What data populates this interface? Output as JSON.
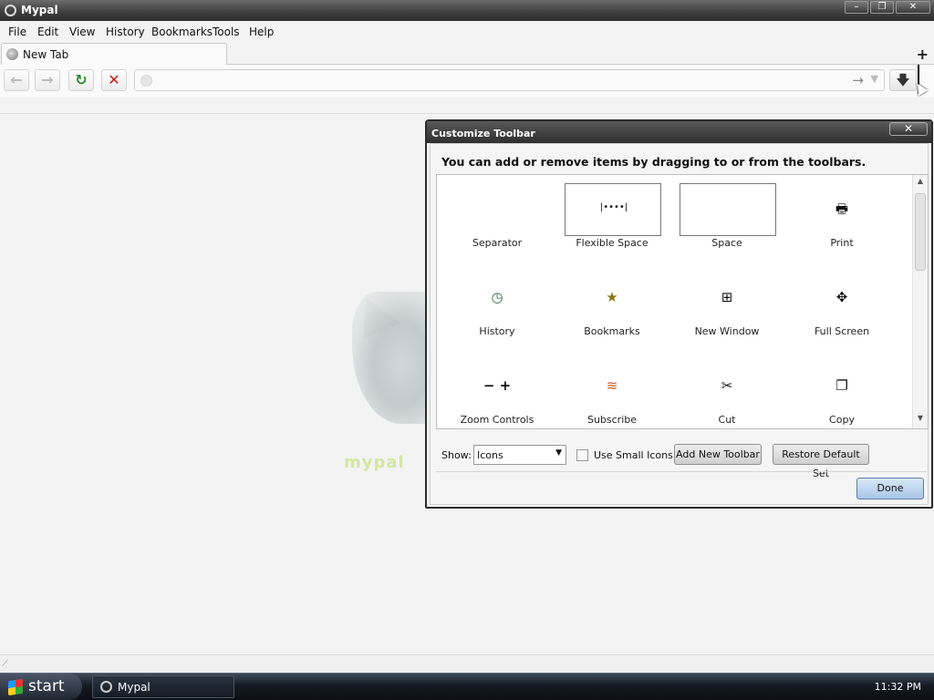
{
  "window": {
    "title": "Mypal",
    "buttons": [
      "–",
      "❐",
      "✕"
    ]
  },
  "menu": [
    "File",
    "Edit",
    "View",
    "History",
    "Bookmarks",
    "Tools",
    "Help"
  ],
  "tabs": [
    {
      "label": "New Tab"
    }
  ],
  "new_tab_symbol": "+",
  "nav": {
    "back": "←",
    "forward": "→",
    "reload": "↻",
    "stop": "✕",
    "go": "→",
    "dropdown": "▼",
    "download": "🡇"
  },
  "background": {
    "wordmark": "mypal"
  },
  "dialog": {
    "title": "Customize Toolbar",
    "close": "✕",
    "instruction": "You can add or remove items by dragging to or from the toolbars.",
    "items": [
      {
        "label": "Separator",
        "icon": ""
      },
      {
        "label": "Flexible Space",
        "icon": "|••••|"
      },
      {
        "label": "Space",
        "icon": ""
      },
      {
        "label": "Print",
        "icon": "🖶"
      },
      {
        "label": "History",
        "icon": "◷"
      },
      {
        "label": "Bookmarks",
        "icon": "★"
      },
      {
        "label": "New Window",
        "icon": "⊞"
      },
      {
        "label": "Full Screen",
        "icon": "✥"
      },
      {
        "label": "Zoom Controls",
        "icon": "−  +"
      },
      {
        "label": "Subscribe",
        "icon": "≋"
      },
      {
        "label": "Cut",
        "icon": "✂"
      },
      {
        "label": "Copy",
        "icon": "❐"
      }
    ],
    "show_label": "Show:",
    "show_value": "Icons",
    "small_icons_label": "Use Small Icons",
    "small_icons_checked": false,
    "add_toolbar": "Add New Toolbar",
    "restore": "Restore Default Set",
    "done": "Done"
  },
  "taskbar": {
    "start": "start",
    "task": "Mypal",
    "clock": "11:32 PM"
  },
  "colors": {
    "titlebar": "#3f3f3f",
    "done_button": "#a9c6e6",
    "wordmark": "#d2e7a0"
  }
}
